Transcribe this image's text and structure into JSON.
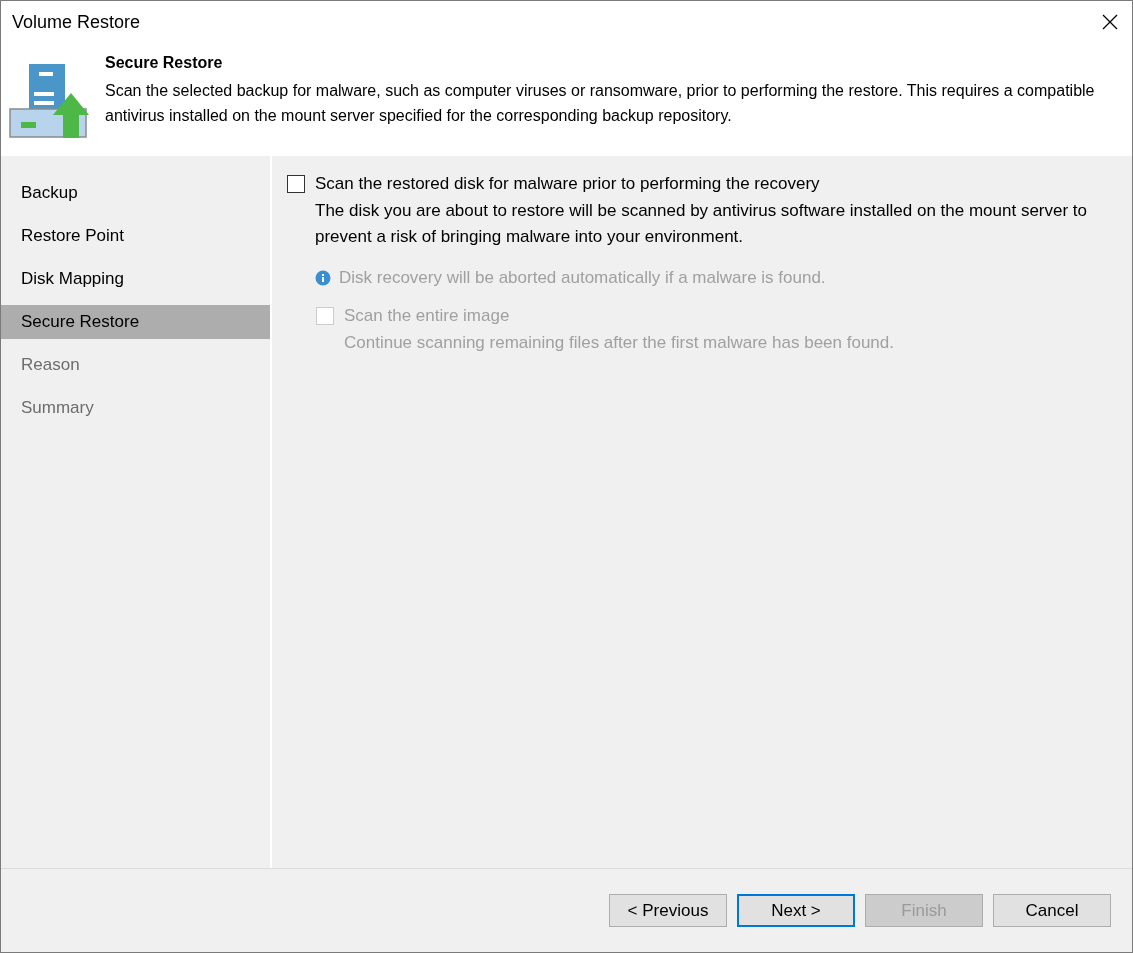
{
  "window": {
    "title": "Volume Restore"
  },
  "header": {
    "title": "Secure Restore",
    "description": "Scan the selected backup for malware, such as computer viruses or ransomware, prior to performing the restore. This requires a compatible antivirus installed on the mount server specified for the corresponding backup repository."
  },
  "steps": [
    {
      "label": "Backup",
      "selected": false,
      "disabled": false
    },
    {
      "label": "Restore Point",
      "selected": false,
      "disabled": false
    },
    {
      "label": "Disk Mapping",
      "selected": false,
      "disabled": false
    },
    {
      "label": "Secure Restore",
      "selected": true,
      "disabled": false
    },
    {
      "label": "Reason",
      "selected": false,
      "disabled": true
    },
    {
      "label": "Summary",
      "selected": false,
      "disabled": true
    }
  ],
  "scan_option": {
    "label": "Scan the restored disk for malware prior to performing the recovery",
    "checked": false,
    "disabled": false,
    "description": "The disk you are about to restore will be scanned by antivirus software installed on the mount server to prevent a risk of bringing malware into your environment."
  },
  "info_note": {
    "text": "Disk recovery will be aborted automatically if a malware is found.",
    "disabled": true
  },
  "entire_image_option": {
    "label": "Scan the entire image",
    "checked": false,
    "disabled": true,
    "description": "Continue scanning remaining files after the first malware has been found."
  },
  "buttons": [
    {
      "label": "< Previous",
      "kind": "normal"
    },
    {
      "label": "Next >",
      "kind": "default"
    },
    {
      "label": "Finish",
      "kind": "disabled"
    },
    {
      "label": "Cancel",
      "kind": "normal"
    }
  ]
}
